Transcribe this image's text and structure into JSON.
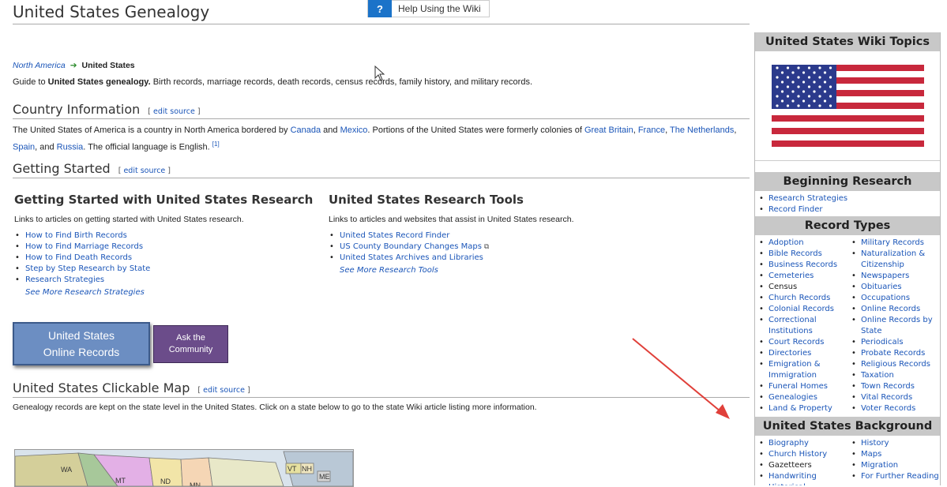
{
  "header": {
    "title": "United States Genealogy",
    "help_icon": "?",
    "help_label": "Help Using the Wiki"
  },
  "breadcrumb": {
    "parent": "North America",
    "arrow": "➔",
    "current": "United States"
  },
  "intro": {
    "prefix": "Guide to ",
    "bold": "United States genealogy.",
    "rest": " Birth records, marriage records, death records, census records, family history, and military records."
  },
  "sections": {
    "country": {
      "title": "Country Information",
      "edit_open": "[",
      "edit": "edit source",
      "edit_close": "]"
    },
    "getting_started": {
      "title": "Getting Started",
      "edit_open": "[",
      "edit": "edit source",
      "edit_close": "]"
    },
    "map": {
      "title": "United States Clickable Map",
      "edit_open": "[",
      "edit": "edit source",
      "edit_close": "]"
    }
  },
  "country_text": {
    "t1": "The United States of America is a country in North America bordered by ",
    "canada": "Canada",
    "and1": " and ",
    "mexico": "Mexico",
    "t2": ". Portions of the United States were formerly colonies of ",
    "gb": "Great Britain",
    "c1": ", ",
    "france": "France",
    "c2": ", ",
    "nl": "The Netherlands",
    "c3": ",",
    "spain": "Spain",
    "and2": ", and ",
    "russia": "Russia",
    "t3": ". The official language is English. ",
    "ref": "[1]"
  },
  "research_col": {
    "title": "Getting Started with United States Research",
    "desc": "Links to articles on getting started with United States research.",
    "items": [
      "How to Find Birth Records",
      "How to Find Marriage Records",
      "How to Find Death Records",
      "Step by Step Research by State",
      "Research Strategies"
    ],
    "more": "See More Research Strategies"
  },
  "tools_col": {
    "title": "United States Research Tools",
    "desc": "Links to articles and websites that assist in United States research.",
    "items": [
      "United States Record Finder",
      "US County Boundary Changes Maps",
      "United States Archives and Libraries"
    ],
    "more": "See More Research Tools"
  },
  "buttons": {
    "online_line1": "United States",
    "online_line2": "Online Records",
    "community_line1": "Ask the",
    "community_line2": "Community"
  },
  "map_text": "Genealogy records are kept on the state level in the United States. Click on a state below to go to the state Wiki article listing more information.",
  "map_labels": [
    "WA",
    "MT",
    "ND",
    "MN",
    "VT",
    "NH",
    "ME"
  ],
  "sidebar": {
    "topics_title": "United States Wiki Topics",
    "beginning_title": "Beginning Research",
    "beginning_items": [
      "Research Strategies",
      "Record Finder"
    ],
    "record_types_title": "Record Types",
    "record_types_col1": [
      "Adoption",
      "Bible Records",
      "Business Records",
      "Cemeteries",
      "Census",
      "Church Records",
      "Colonial Records",
      "Correctional Institutions",
      "Court Records",
      "Directories",
      "Emigration & Immigration",
      "Funeral Homes",
      "Genealogies",
      "Land & Property"
    ],
    "record_types_col2": [
      "Military Records",
      "Naturalization & Citizenship",
      "Newspapers",
      "Obituaries",
      "Occupations",
      "Online Records",
      "Online Records by State",
      "Periodicals",
      "Probate Records",
      "Religious Records",
      "Taxation",
      "Town Records",
      "Vital Records",
      "Voter Records"
    ],
    "background_title": "United States Background",
    "background_col1": [
      "Biography",
      "Church History",
      "Gazetteers",
      "Handwriting",
      "Historical Geography"
    ],
    "background_col2": [
      "History",
      "Maps",
      "Migration",
      "For Further Reading"
    ]
  },
  "colors": {
    "link": "#1a55b8",
    "header_gray": "#c8c8c8",
    "online_btn": "#6c8ec2",
    "community_btn": "#6b4c8a",
    "arrow": "#e0403a"
  }
}
